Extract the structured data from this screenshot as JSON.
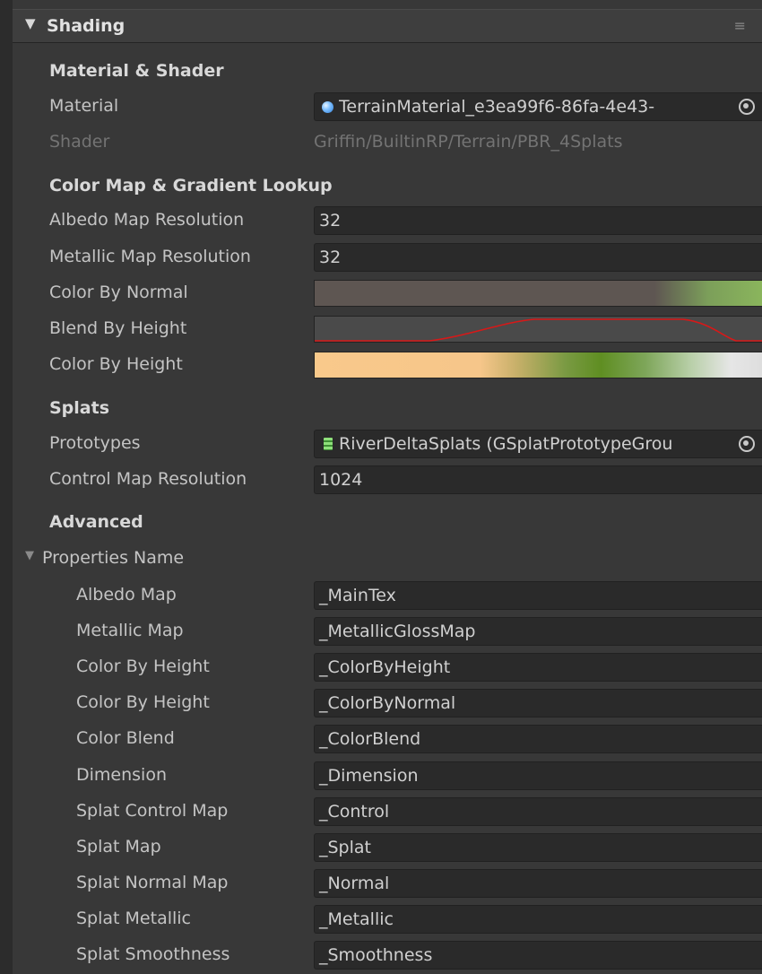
{
  "header": {
    "title": "Shading",
    "arrow_icon": "triangle-down-icon",
    "menu_icon": "hamburger-menu-icon"
  },
  "material_shader": {
    "section_title": "Material & Shader",
    "material_label": "Material",
    "material_value": "TerrainMaterial_e3ea99f6-86fa-4e43-",
    "shader_label": "Shader",
    "shader_value": "Griffin/BuiltinRP/Terrain/PBR_4Splats"
  },
  "color_map": {
    "section_title": "Color Map & Gradient Lookup",
    "albedo_res_label": "Albedo Map Resolution",
    "albedo_res_value": "32",
    "metallic_res_label": "Metallic Map Resolution",
    "metallic_res_value": "32",
    "color_by_normal_label": "Color By Normal",
    "blend_by_height_label": "Blend By Height",
    "color_by_height_label": "Color By Height",
    "curve_color": "#d81818"
  },
  "splats": {
    "section_title": "Splats",
    "prototypes_label": "Prototypes",
    "prototypes_value": "RiverDeltaSplats (GSplatPrototypeGrou",
    "control_res_label": "Control Map Resolution",
    "control_res_value": "1024"
  },
  "advanced": {
    "section_title": "Advanced",
    "foldout_label": "Properties Name",
    "properties": [
      {
        "label": "Albedo Map",
        "value": "_MainTex"
      },
      {
        "label": "Metallic Map",
        "value": "_MetallicGlossMap"
      },
      {
        "label": "Color By Height",
        "value": "_ColorByHeight"
      },
      {
        "label": "Color By Height",
        "value": "_ColorByNormal"
      },
      {
        "label": "Color Blend",
        "value": "_ColorBlend"
      },
      {
        "label": "Dimension",
        "value": "_Dimension"
      },
      {
        "label": "Splat Control Map",
        "value": "_Control"
      },
      {
        "label": "Splat Map",
        "value": "_Splat"
      },
      {
        "label": "Splat Normal Map",
        "value": "_Normal"
      },
      {
        "label": "Splat Metallic",
        "value": "_Metallic"
      },
      {
        "label": "Splat Smoothness",
        "value": "_Smoothness"
      }
    ]
  }
}
